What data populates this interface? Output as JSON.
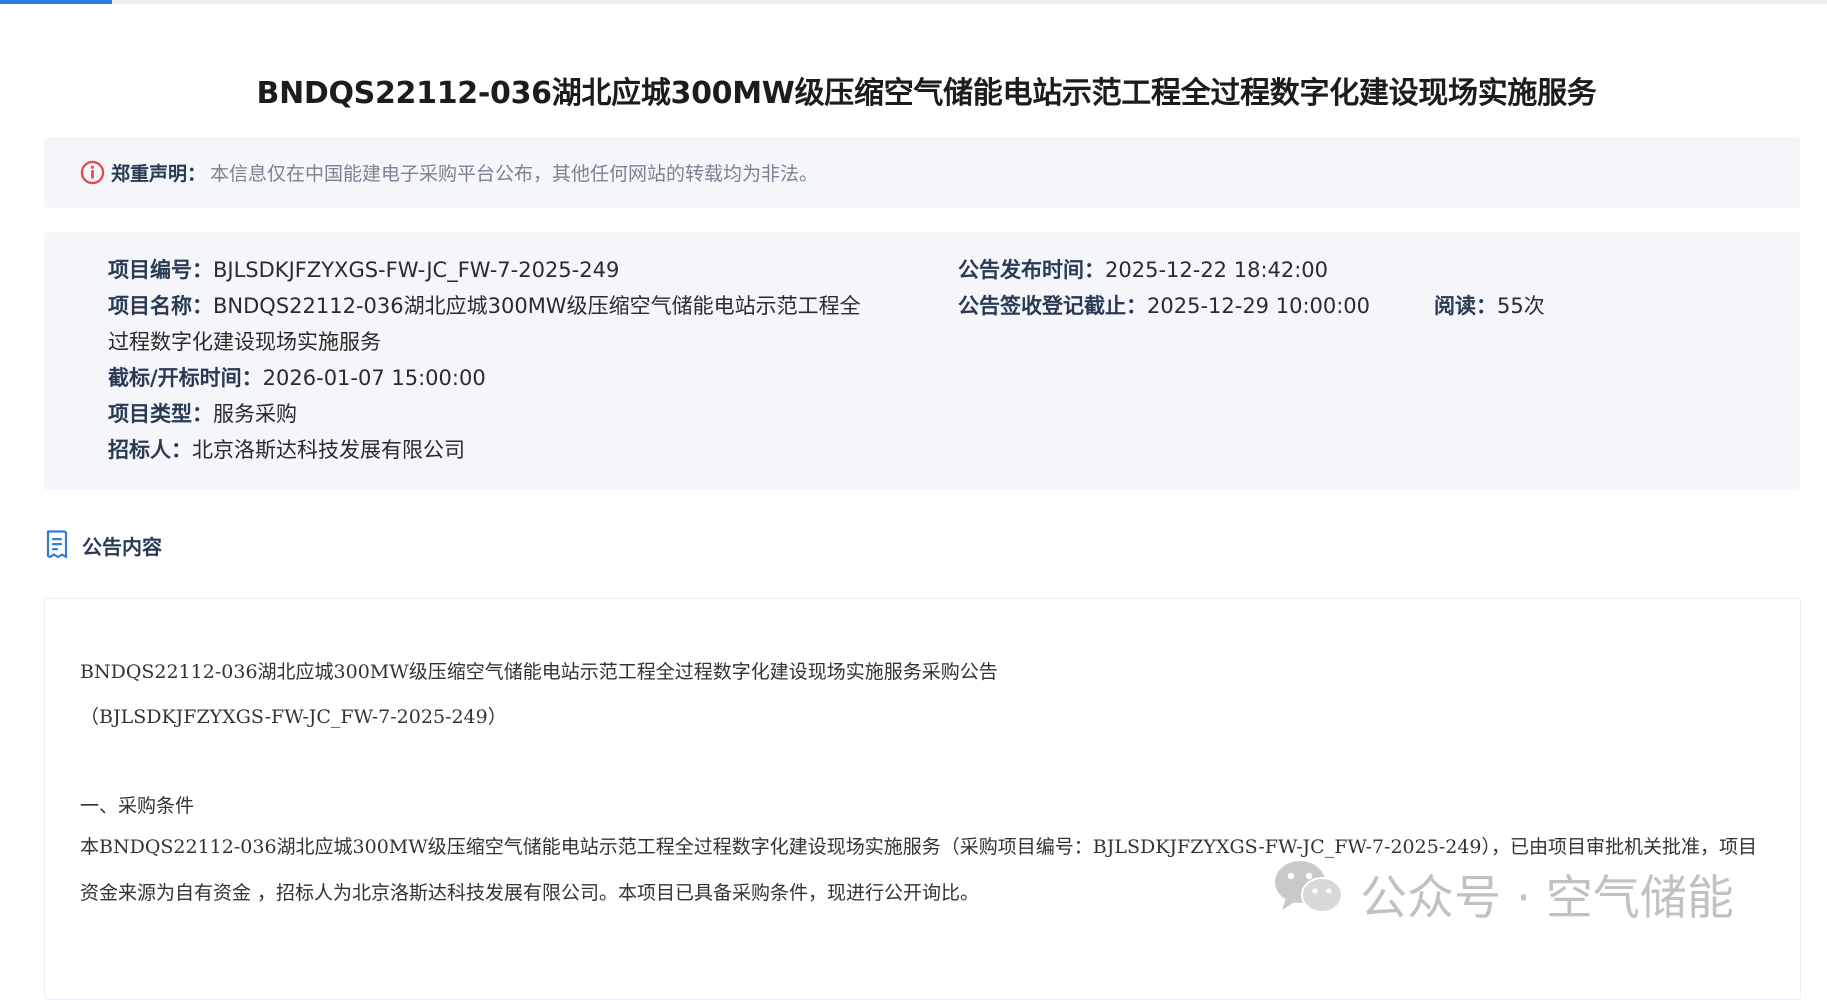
{
  "title": "BNDQS22112-036湖北应城300MW级压缩空气储能电站示范工程全过程数字化建设现场实施服务",
  "notice": {
    "label": "郑重声明：",
    "text": "本信息仅在中国能建电子采购平台公布，其他任何网站的转载均为非法。",
    "icon": "warning-circle-icon",
    "icon_color": "#e5484d"
  },
  "info": {
    "project_no_label": "项目编号：",
    "project_no": "BJLSDKJFZYXGS-FW-JC_FW-7-2025-249",
    "project_name_label": "项目名称：",
    "project_name": "BNDQS22112-036湖北应城300MW级压缩空气储能电站示范工程全过程数字化建设现场实施服务",
    "deadline_label": "截标/开标时间：",
    "deadline": "2026-01-07 15:00:00",
    "type_label": "项目类型：",
    "type": "服务采购",
    "tenderer_label": "招标人：",
    "tenderer": "北京洛斯达科技发展有限公司",
    "publish_label": "公告发布时间：",
    "publish_time": "2025-12-22 18:42:00",
    "signup_label": "公告签收登记截止：",
    "signup_deadline": "2025-12-29 10:00:00",
    "reads_label": "阅读：",
    "reads": "55次"
  },
  "section": {
    "title": "公告内容",
    "icon": "document-icon",
    "icon_color": "#2f7ae5"
  },
  "content": {
    "heading": "BNDQS22112-036湖北应城300MW级压缩空气储能电站示范工程全过程数字化建设现场实施服务采购公告",
    "code": "（BJLSDKJFZYXGS-FW-JC_FW-7-2025-249）",
    "sub_heading": "一、采购条件",
    "paragraph": "本BNDQS22112-036湖北应城300MW级压缩空气储能电站示范工程全过程数字化建设现场实施服务（采购项目编号：BJLSDKJFZYXGS-FW-JC_FW-7-2025-249），已由项目审批机关批准，项目资金来源为自有资金 ，招标人为北京洛斯达科技发展有限公司。本项目已具备采购条件，现进行公开询比。"
  },
  "watermark": {
    "text": "公众号 · 空气储能",
    "icon": "wechat-icon"
  },
  "colors": {
    "accent": "#2f7ae5",
    "panel_bg": "#f4f6f9",
    "label": "#2a3a55"
  }
}
